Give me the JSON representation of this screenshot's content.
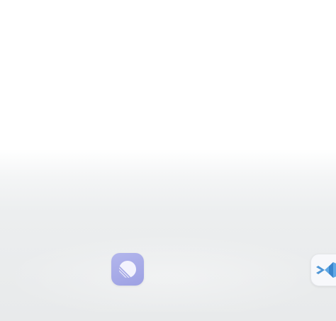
{
  "dock": {
    "apps": [
      {
        "name": "linear",
        "icon": "linear-app-icon",
        "color": "#a5a8e6"
      },
      {
        "name": "vscode",
        "icon": "vscode-app-icon",
        "color": "#5aa3df"
      }
    ]
  },
  "colors": {
    "background_top": "#ffffff",
    "background_bottom": "#e8eaeb"
  }
}
